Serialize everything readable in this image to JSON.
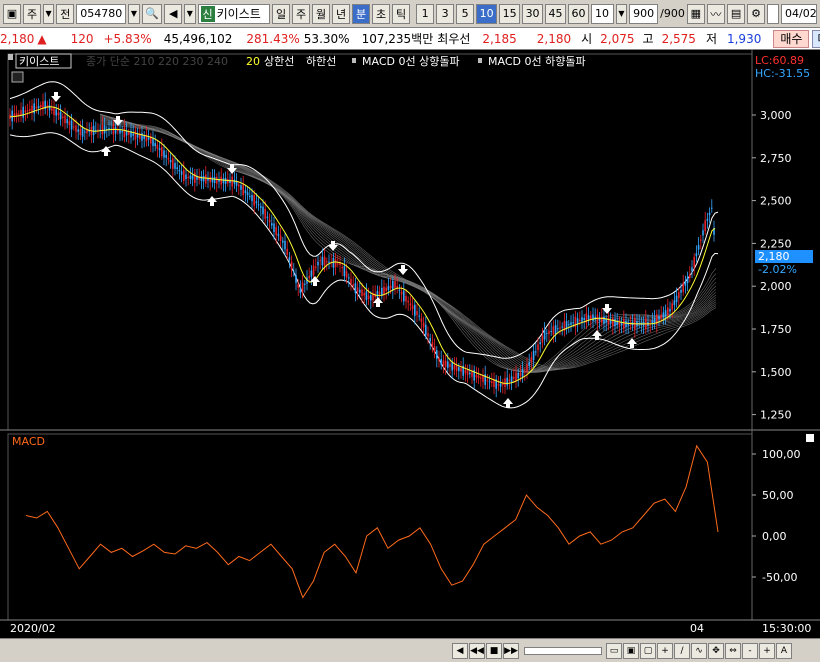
{
  "toolbar": {
    "market": "주",
    "type": "전",
    "code": "054780",
    "badge": "신",
    "name": "키이스트",
    "periods": [
      "일",
      "주",
      "월",
      "년",
      "분",
      "초",
      "틱"
    ],
    "active_period": "분",
    "minutes": [
      "1",
      "3",
      "5",
      "10",
      "15",
      "30",
      "45",
      "60"
    ],
    "active_minute": "10",
    "count": "10",
    "bars": "900",
    "bars_total": "/900",
    "date": "04/02"
  },
  "quote": {
    "price": "2,180",
    "arrow": "▲",
    "change": "120",
    "change_pct": "+5.83%",
    "volume": "45,496,102",
    "vol_ratio": "281.43%",
    "turnover": "53.30%",
    "amount": "107,235백만",
    "best_label": "최우선",
    "ask": "2,185",
    "bid": "2,180",
    "open_label": "시",
    "open": "2,075",
    "high_label": "고",
    "high": "2,575",
    "low_label": "저",
    "low": "1,930",
    "buy_btn": "매수",
    "sell_btn": "매"
  },
  "legend": {
    "name": "키이스트",
    "ma_label": "종가 단순 210  220  230  240",
    "ma20": "20",
    "upper": "상한선",
    "lower": "하한선",
    "macd_up": "MACD 0선 상향돌파",
    "macd_down": "MACD 0선 하향돌파"
  },
  "price_scale": {
    "lc": "LC:60.89",
    "hc": "HC:-31.55",
    "ticks": [
      "3,000",
      "2,750",
      "2,500",
      "2,250",
      "2,000",
      "1,750",
      "1,500",
      "1,250"
    ],
    "current": "2,180",
    "current_pct": "-2.02%"
  },
  "macd_panel": {
    "title": "MACD",
    "ticks": [
      "100,00",
      "50,00",
      "0,00",
      "-50,00"
    ]
  },
  "time_axis": {
    "start": "2020/02",
    "mid": "04",
    "end": "15:30:00"
  },
  "colors": {
    "candle_up": "#e8222a",
    "candle_down": "#35a7ff",
    "ma20": "#ffff30",
    "band": "#ffffff",
    "macd": "#ff6a1a"
  },
  "chart_data": [
    {
      "type": "line",
      "title": "",
      "series": [
        {
          "name": "MACD",
          "values": [
            25,
            22,
            30,
            10,
            -15,
            -40,
            -25,
            -10,
            -20,
            -15,
            -25,
            -18,
            -10,
            -20,
            -22,
            -12,
            -15,
            -8,
            -20,
            -35,
            -25,
            -30,
            -20,
            -10,
            -25,
            -40,
            -75,
            -55,
            -20,
            -10,
            -25,
            -45,
            0,
            10,
            -15,
            -5,
            0,
            10,
            -10,
            -40,
            -60,
            -55,
            -35,
            -10,
            0,
            10,
            20,
            50,
            35,
            25,
            10,
            -10,
            0,
            5,
            -10,
            -5,
            5,
            10,
            25,
            40,
            45,
            30,
            60,
            110,
            90,
            5
          ]
        }
      ],
      "ylim": [
        -100,
        125
      ]
    }
  ]
}
